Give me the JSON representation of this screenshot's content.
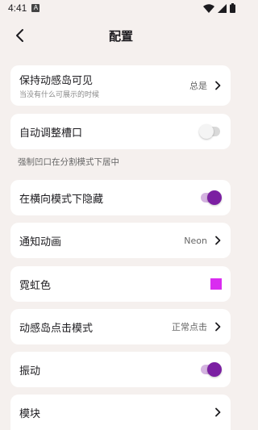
{
  "status_bar": {
    "time": "4:41",
    "notification": "A"
  },
  "header": {
    "title": "配置"
  },
  "colors": {
    "accent": "#7b1fa2",
    "neon": "#d92cf0"
  },
  "items": {
    "island_visible": {
      "label": "保持动感岛可见",
      "sub": "当没有什么可展示的时候",
      "value": "总是"
    },
    "auto_notch": {
      "label": "自动调整槽口",
      "helper": "强制凹口在分割模式下居中",
      "on": false
    },
    "hide_landscape": {
      "label": "在横向模式下隐藏",
      "on": true
    },
    "notif_anim": {
      "label": "通知动画",
      "value": "Neon"
    },
    "neon_color": {
      "label": "霓虹色"
    },
    "click_mode": {
      "label": "动感岛点击模式",
      "value": "正常点击"
    },
    "vibration": {
      "label": "振动",
      "on": true
    },
    "modules": {
      "label": "模块"
    }
  }
}
